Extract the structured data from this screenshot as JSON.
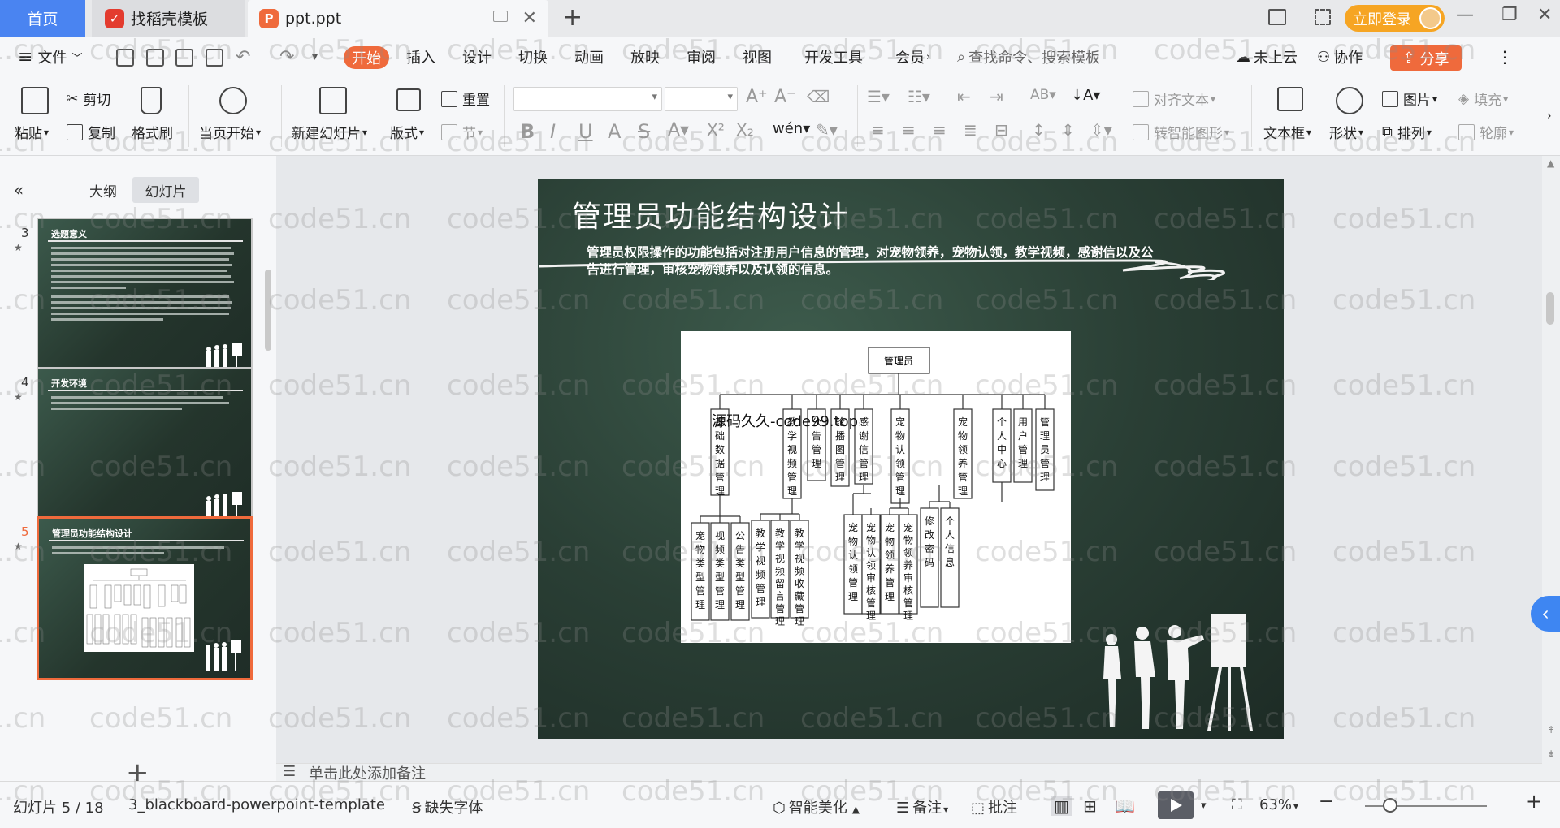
{
  "titlebar": {
    "home_tab": "首页",
    "doc_tab": "找稻壳模板",
    "file_tab": "ppt.ppt",
    "login_button": "立即登录"
  },
  "menubar": {
    "file_menu": "文件",
    "items": [
      "开始",
      "插入",
      "设计",
      "切换",
      "动画",
      "放映",
      "审阅",
      "视图",
      "开发工具",
      "会员"
    ],
    "search_placeholder": "查找命令、搜索模板",
    "cloud": "未上云",
    "collab": "协作",
    "share": "分享"
  },
  "ribbon": {
    "paste": "粘贴",
    "cut": "剪切",
    "copy": "复制",
    "format_painter": "格式刷",
    "from_current": "当页开始",
    "new_slide": "新建幻灯片",
    "layout": "版式",
    "section": "节",
    "reset": "重置",
    "align_text": "对齐文本",
    "to_smartart": "转智能图形",
    "textbox": "文本框",
    "shape": "形状",
    "picture": "图片",
    "arrange": "排列",
    "fill": "填充",
    "outline": "轮廓"
  },
  "leftpanel": {
    "tab_outline": "大纲",
    "tab_slides": "幻灯片",
    "thumbs": [
      {
        "num": "3",
        "title": "选题意义"
      },
      {
        "num": "4",
        "title": "开发环境"
      },
      {
        "num": "5",
        "title": "管理员功能结构设计"
      }
    ]
  },
  "slide": {
    "title": "管理员功能结构设计",
    "subtitle": "管理员权限操作的功能包括对注册用户信息的管理，对宠物领养，宠物认领，教学视频，感谢信以及公告进行管理，审核宠物领养以及认领的信息。",
    "source_watermark": "源码久久-code99.top",
    "org_root": "管理员",
    "org_level1": [
      "基础数据管理",
      "教学视频管理",
      "公告管理",
      "轮播图管理",
      "感谢信管理",
      "宠物认领管理",
      "宠物领养管理",
      "个人中心",
      "用户管理",
      "管理员管理"
    ],
    "org_level2": [
      "宠物类型管理",
      "视频类型管理",
      "公告类型管理",
      "教学视频管理",
      "教学视频留言管理",
      "教学视频收藏管理",
      "宠物认领管理",
      "宠物认领审核管理",
      "宠物领养管理",
      "宠物领养审核管理",
      "修改密码",
      "个人信息"
    ]
  },
  "notes_placeholder": "单击此处添加备注",
  "statusbar": {
    "slide_info": "幻灯片 5 / 18",
    "template": "3_blackboard-powerpoint-template",
    "missing_font": "缺失字体",
    "beautify": "智能美化",
    "notes": "备注",
    "comments": "批注",
    "zoom": "63%"
  },
  "site_watermark": "code51.cn",
  "colors": {
    "accent": "#ef6a3c",
    "home_tab": "#4a84f1",
    "login": "#f6a523",
    "slide_bg": "#2a3f35"
  }
}
